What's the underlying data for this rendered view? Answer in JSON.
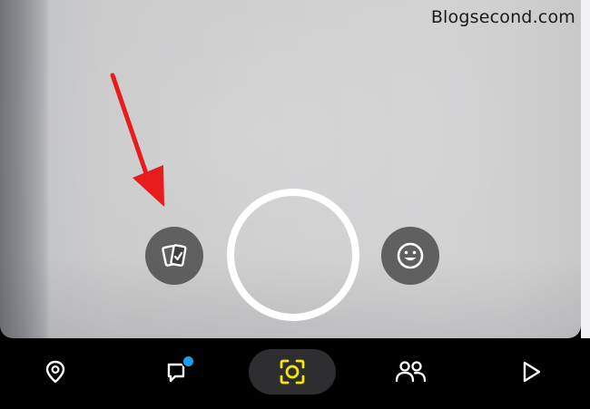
{
  "watermark": {
    "text": "Blogsecond.com"
  },
  "camera": {
    "memories_icon": "memories-cards-icon",
    "shutter_icon": "shutter-ring-icon",
    "lens_icon": "smiley-lens-icon"
  },
  "annotation": {
    "arrow_icon": "red-arrow-icon",
    "arrow_color": "#e81c1c"
  },
  "bottom_nav": {
    "items": [
      {
        "icon": "map-pin-icon"
      },
      {
        "icon": "chat-bubble-icon",
        "has_notification": true
      },
      {
        "icon": "camera-scan-icon",
        "active": true
      },
      {
        "icon": "friends-icon"
      },
      {
        "icon": "play-icon"
      }
    ]
  },
  "colors": {
    "active_icon": "#f5e500",
    "notification": "#1e9fe8",
    "nav_background": "#000000",
    "icon_default": "#ffffff"
  }
}
